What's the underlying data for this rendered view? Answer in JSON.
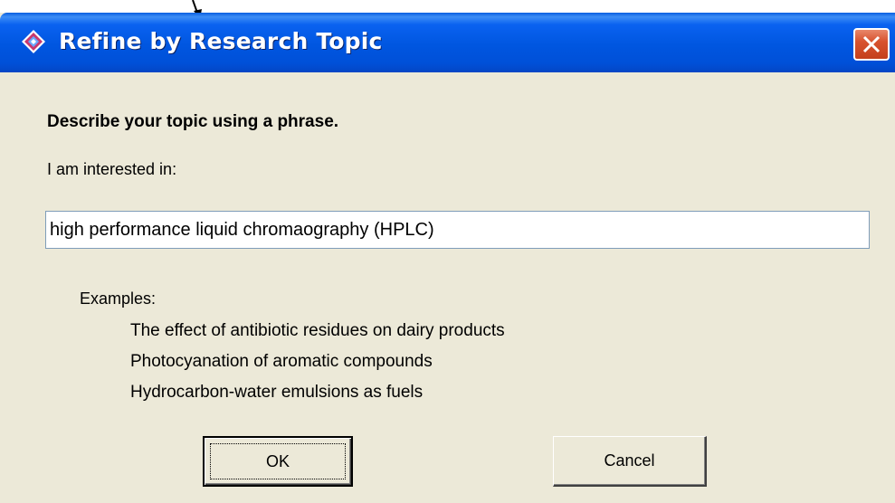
{
  "window": {
    "title": "Refine by Research Topic",
    "icon": "app-diamond-icon",
    "close_icon": "close-icon"
  },
  "form": {
    "heading": "Describe your topic using a phrase.",
    "interest_label": "I am interested in:",
    "topic_value": "high performance liquid chromaography (HPLC)"
  },
  "examples": {
    "label": "Examples:",
    "items": [
      "The effect of antibiotic residues on dairy products",
      "Photocyanation of aromatic compounds",
      "Hydrocarbon-water emulsions as fuels"
    ]
  },
  "buttons": {
    "ok": "OK",
    "cancel": "Cancel"
  },
  "colors": {
    "titlebar": "#0055e5",
    "dialog_bg": "#ece9d8",
    "close_button": "#d8532f"
  }
}
